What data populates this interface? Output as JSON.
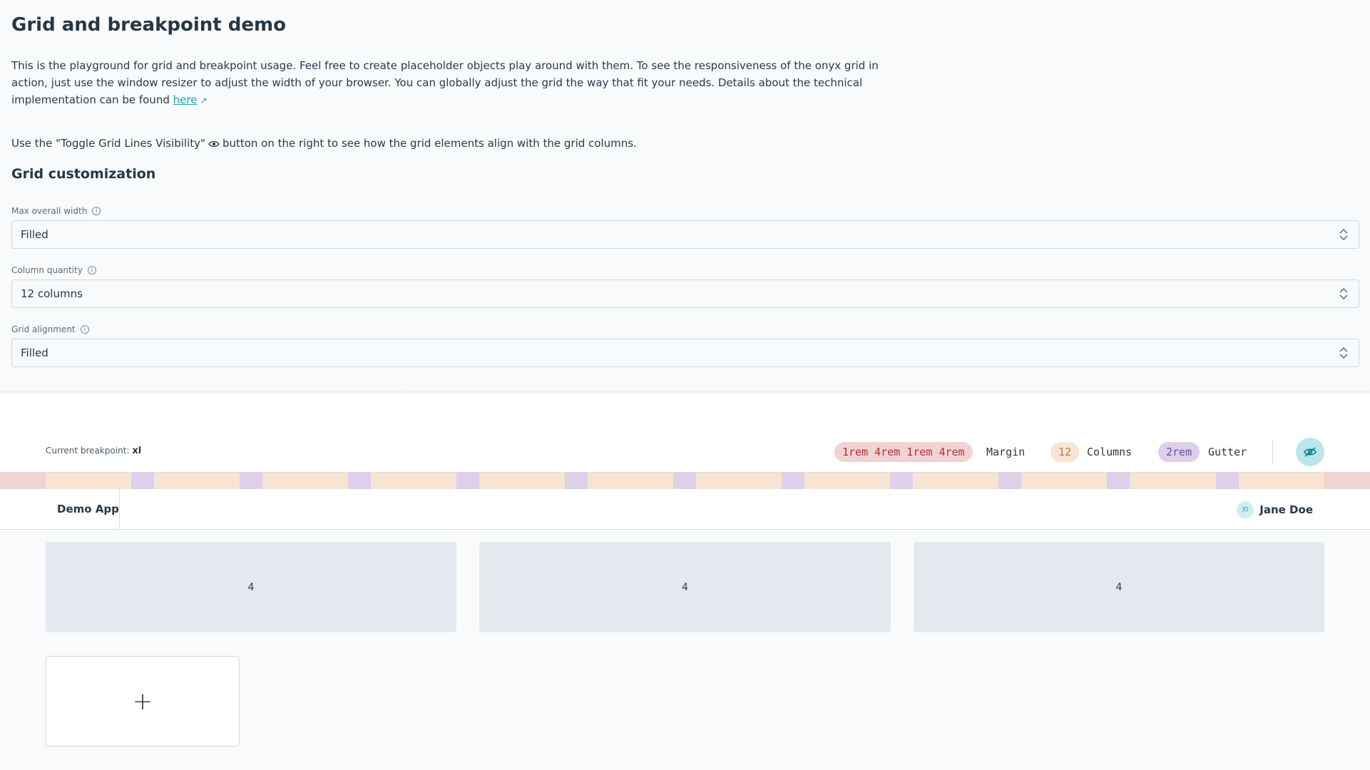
{
  "page": {
    "title": "Grid and breakpoint demo",
    "description": "This is the playground for grid and breakpoint usage. Feel free to create placeholder objects play around with them. To see the responsiveness of the onyx grid in action, just use the window resizer to adjust the width of your browser. You can globally adjust the grid the way that fit your needs. Details about the technical implementation can be found ",
    "description_link": "here",
    "hint_before": "Use the \"Toggle Grid Lines Visibility\"",
    "hint_after": "button on the right to see how the grid elements align with the grid columns.",
    "section_title": "Grid customization"
  },
  "fields": {
    "max_width": {
      "label": "Max overall width",
      "value": "Filled"
    },
    "column_quantity": {
      "label": "Column quantity",
      "value": "12 columns"
    },
    "grid_alignment": {
      "label": "Grid alignment",
      "value": "Filled"
    }
  },
  "status": {
    "breakpoint_label": "Current breakpoint:",
    "breakpoint_value": "xl",
    "margin_value": "1rem 4rem 1rem 4rem",
    "margin_label": "Margin",
    "columns_value": "12",
    "columns_label": "Columns",
    "gutter_value": "2rem",
    "gutter_label": "Gutter"
  },
  "appbar": {
    "app_name": "Demo App",
    "user_initials": "JD",
    "user_name": "Jane Doe"
  },
  "tiles": [
    "4",
    "4",
    "4"
  ],
  "add_tile": {
    "symbol": "+"
  },
  "icons": {
    "info": "info-icon",
    "external": "external-link-icon",
    "eye": "eye-icon",
    "eye_off": "eye-off-icon",
    "chevrons": "chevron-up-down-icon"
  },
  "colors": {
    "accent": "#16a7b4",
    "margin": "#f2d3d3",
    "column": "#f7e4d3",
    "gutter": "#dcd0ea"
  }
}
